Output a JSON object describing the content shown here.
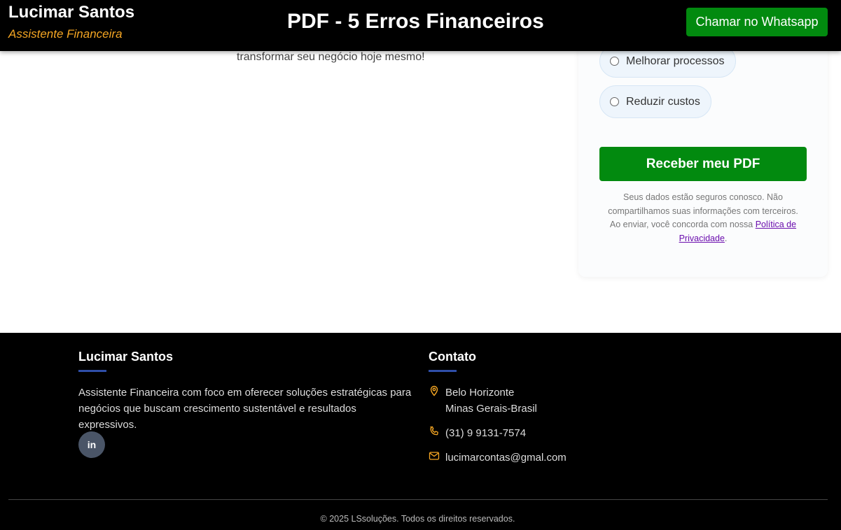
{
  "header": {
    "brand_name": "Lucimar Santos",
    "brand_tagline": "Assistente Financeira",
    "title": "PDF - 5 Erros Financeiros",
    "whatsapp_button": "Chamar no Whatsapp"
  },
  "intro": {
    "tail_text": "transformar seu negócio hoje mesmo!"
  },
  "form": {
    "options": [
      {
        "label": "Melhorar processos",
        "selected": false
      },
      {
        "label": "Reduzir custos",
        "selected": false
      }
    ],
    "submit_label": "Receber meu PDF",
    "privacy_text": "Seus dados estão seguros conosco. Não compartilhamos suas informações com terceiros. Ao enviar, você concorda com nossa ",
    "privacy_link": "Política de Privacidade",
    "privacy_end": "."
  },
  "footer": {
    "about_heading": "Lucimar Santos",
    "about_text": "Assistente Financeira com foco em oferecer soluções estratégicas para negócios que buscam crescimento sustentável e resultados expressivos.",
    "linkedin_icon": "in",
    "contact_heading": "Contato",
    "address_line1": "Belo Horizonte",
    "address_line2": "Minas Gerais-Brasil",
    "phone": "(31) 9 9131-7574",
    "email": "lucimarcontas@gmal.com",
    "copyright": "© 2025 LSsoluções. Todos os direitos reservados."
  },
  "colors": {
    "accent_green": "#028a0f",
    "tagline_orange": "#f5a623",
    "link_purple": "#6a0dad"
  }
}
